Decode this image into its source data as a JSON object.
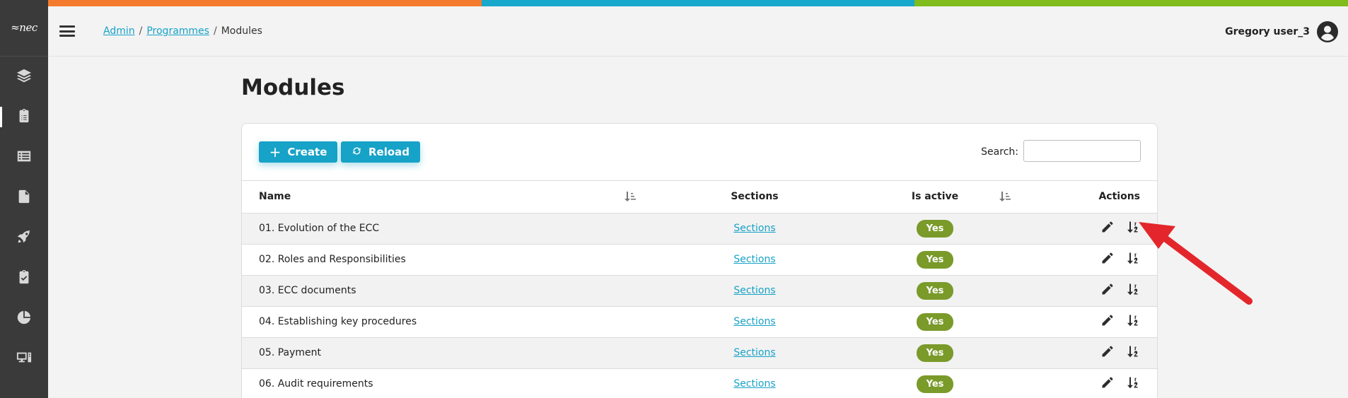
{
  "colors": {
    "topbar": [
      "#f47b2e",
      "#17a8cc",
      "#80bc1c"
    ],
    "accent": "#17a2c7",
    "active_badge": "#7a9a2a",
    "sidebar_bg": "#3a3a3a",
    "annotation_arrow": "#e3262b"
  },
  "logo": {
    "mark": "≈nec",
    "tagline": ""
  },
  "sidebar": {
    "items": [
      {
        "icon": "layers-icon",
        "active": false
      },
      {
        "icon": "clipboard-list-icon",
        "active": true
      },
      {
        "icon": "list-icon",
        "active": false
      },
      {
        "icon": "document-icon",
        "active": false
      },
      {
        "icon": "rocket-icon",
        "active": false
      },
      {
        "icon": "clipboard-check-icon",
        "active": false
      },
      {
        "icon": "pie-chart-icon",
        "active": false
      },
      {
        "icon": "desktop-icon",
        "active": false
      }
    ]
  },
  "breadcrumb": {
    "items": [
      "Admin",
      "Programmes"
    ],
    "current": "Modules",
    "separator": "/"
  },
  "user": {
    "name": "Gregory user_3",
    "icon": "user-circle-icon"
  },
  "page": {
    "title": "Modules"
  },
  "toolbar": {
    "create_label": "Create",
    "reload_label": "Reload",
    "search_label": "Search:",
    "search_value": ""
  },
  "table": {
    "columns": {
      "name": "Name",
      "sections": "Sections",
      "is_active": "Is active",
      "actions": "Actions"
    },
    "rows": [
      {
        "name": "01. Evolution of the ECC",
        "sections": "Sections",
        "active": "Yes"
      },
      {
        "name": "02. Roles and Responsibilities",
        "sections": "Sections",
        "active": "Yes"
      },
      {
        "name": "03. ECC documents",
        "sections": "Sections",
        "active": "Yes"
      },
      {
        "name": "04. Establishing key procedures",
        "sections": "Sections",
        "active": "Yes"
      },
      {
        "name": "05. Payment",
        "sections": "Sections",
        "active": "Yes"
      },
      {
        "name": "06. Audit requirements",
        "sections": "Sections",
        "active": "Yes"
      }
    ]
  }
}
